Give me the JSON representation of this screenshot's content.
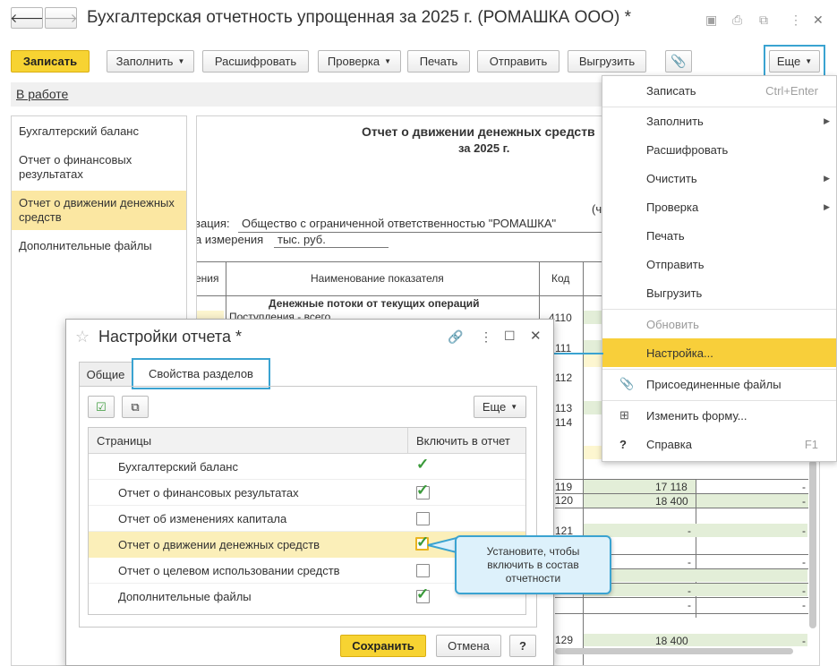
{
  "window": {
    "title": "Бухгалтерская отчетность упрощенная за 2025 г. (РОМАШКА ООО) *",
    "back_icon": "arrow-left-icon",
    "forward_icon": "arrow-right-icon"
  },
  "toolbar": {
    "save": "Записать",
    "fill": "Заполнить",
    "decode": "Расшифровать",
    "check": "Проверка",
    "print": "Печать",
    "send": "Отправить",
    "upload": "Выгрузить",
    "more": "Еще"
  },
  "status_link": "В работе",
  "sidebar": {
    "items": [
      {
        "label": "Бухгалтерский баланс"
      },
      {
        "label": "Отчет о финансовых результатах"
      },
      {
        "label": "Отчет о движении денежных средств"
      },
      {
        "label": "Дополнительные файлы"
      }
    ]
  },
  "report": {
    "title": "Отчет о движении денежных средств",
    "period": "за 2025 г.",
    "partial_right": "(ч",
    "org_label": "зация:",
    "org_value": "Общество с ограниченной ответственностью \"РОМАШКА\"",
    "unit_label": "а измерения",
    "unit_value": "тыс. руб.",
    "col_partial": "ения",
    "col_name": "Наименование показателя",
    "col_code": "Код",
    "section": "Денежные потоки от текущих операций",
    "row_income": "Поступления - всего",
    "codes": [
      "4110",
      "111",
      "112",
      "113",
      "114",
      "119",
      "120",
      "121",
      "129"
    ],
    "values": {
      "v119": "17 118",
      "v120": "18 400",
      "v129": "18 400",
      "dash": "-"
    }
  },
  "menu": {
    "items": [
      {
        "label": "Записать",
        "shortcut": "Ctrl+Enter"
      },
      {
        "label": "Заполнить"
      },
      {
        "label": "Расшифровать"
      },
      {
        "label": "Очистить"
      },
      {
        "label": "Проверка"
      },
      {
        "label": "Печать"
      },
      {
        "label": "Отправить"
      },
      {
        "label": "Выгрузить"
      },
      {
        "label": "Обновить"
      },
      {
        "label": "Настройка..."
      },
      {
        "label": "Присоединенные файлы"
      },
      {
        "label": "Изменить форму..."
      },
      {
        "label": "Справка",
        "shortcut": "F1",
        "icon": "?"
      }
    ]
  },
  "dialog": {
    "title": "Настройки отчета *",
    "tabs": [
      "Общие",
      "Свойства разделов"
    ],
    "more": "Еще",
    "col_pages": "Страницы",
    "col_include": "Включить в отчет",
    "rows": [
      {
        "name": "Бухгалтерский баланс",
        "checked": true,
        "plain": true
      },
      {
        "name": "Отчет о финансовых результатах",
        "checked": true
      },
      {
        "name": "Отчет об изменениях капитала",
        "checked": false
      },
      {
        "name": "Отчет о движении денежных средств",
        "checked": true
      },
      {
        "name": "Отчет о целевом использовании средств",
        "checked": false
      },
      {
        "name": "Дополнительные файлы",
        "checked": true
      }
    ],
    "save": "Сохранить",
    "cancel": "Отмена",
    "help": "?"
  },
  "tooltip": "Установите, чтобы включить в состав отчетности",
  "colors": {
    "accent_yellow": "#f8cf3a",
    "selection": "#fbe7a2",
    "callout_border": "#3aa3d1",
    "check_green": "#3a9a3a"
  }
}
